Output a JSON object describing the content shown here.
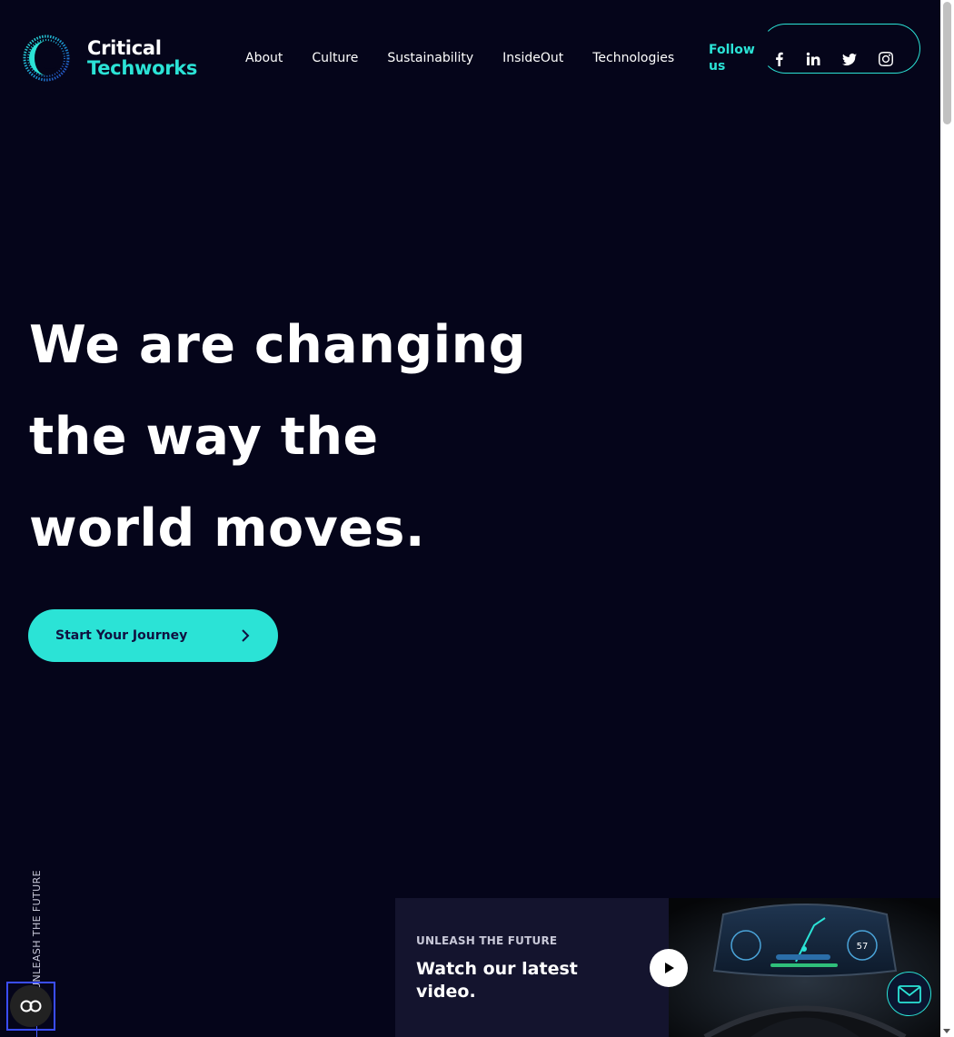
{
  "brand": {
    "name_line1": "Critical",
    "name_line2": "Techworks",
    "accent": "#2be3d6",
    "background": "#05051a"
  },
  "nav": {
    "items": [
      "About",
      "Culture",
      "Sustainability",
      "InsideOut",
      "Technologies"
    ],
    "follow_label": "Follow us",
    "social": [
      "facebook-icon",
      "linkedin-icon",
      "twitter-icon",
      "instagram-icon"
    ]
  },
  "hero": {
    "title_line1": "We are changing",
    "title_line2": "the way the",
    "title_line3": "world moves.",
    "cta_label": "Start Your Journey"
  },
  "side": {
    "vertical_text": "UNLEASH THE FUTURE",
    "a11y_label": "CO"
  },
  "video": {
    "kicker": "UNLEASH THE FUTURE",
    "title": "Watch our latest video.",
    "dash_speed": "57"
  }
}
